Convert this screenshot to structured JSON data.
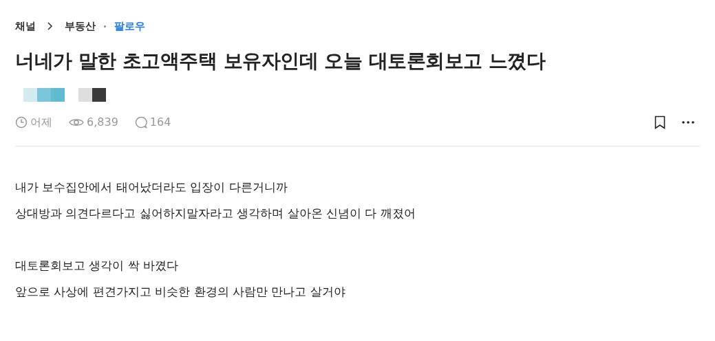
{
  "breadcrumb": {
    "root": "채널",
    "channel": "부동산",
    "follow": "팔로우"
  },
  "title": "너네가 말한 초고액주택 보유자인데 오늘 대토론회보고 느꼈다",
  "meta": {
    "time": "어제",
    "views": "6,839",
    "comments": "164"
  },
  "body": [
    [
      "내가 보수집안에서 태어났더라도 입장이 다른거니까",
      "상대방과 의견다르다고 싫어하지말자라고 생각하며 살아온 신념이 다 깨졌어"
    ],
    [
      "대토론회보고 생각이 싹 바꼈다",
      "앞으로 사상에 편견가지고 비슷한 환경의 사람만 만나고 살거야"
    ]
  ]
}
